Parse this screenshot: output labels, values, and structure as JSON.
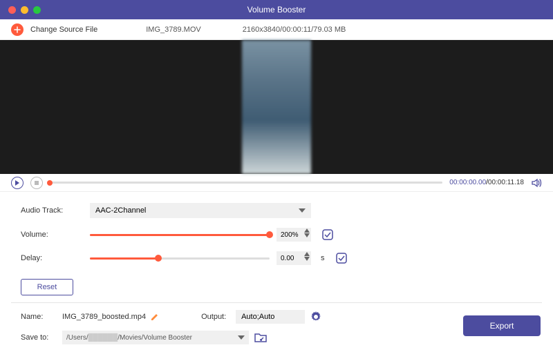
{
  "titlebar": {
    "title": "Volume Booster"
  },
  "source": {
    "change_label": "Change Source File",
    "filename": "IMG_3789.MOV",
    "info": "2160x3840/00:00:11/79.03 MB"
  },
  "playback": {
    "current": "00:00:00.00",
    "duration": "00:00:11.18"
  },
  "controls": {
    "audio_track_label": "Audio Track:",
    "audio_track_value": "AAC-2Channel",
    "volume_label": "Volume:",
    "volume_value": "200%",
    "volume_fill_pct": 100,
    "delay_label": "Delay:",
    "delay_value": "0.00",
    "delay_unit": "s",
    "delay_fill_pct": 38,
    "reset_label": "Reset"
  },
  "output": {
    "name_label": "Name:",
    "name_value": "IMG_3789_boosted.mp4",
    "output_label": "Output:",
    "output_value": "Auto;Auto",
    "saveto_label": "Save to:",
    "saveto_prefix": "/Users/",
    "saveto_suffix": "/Movies/Volume Booster",
    "export_label": "Export"
  }
}
